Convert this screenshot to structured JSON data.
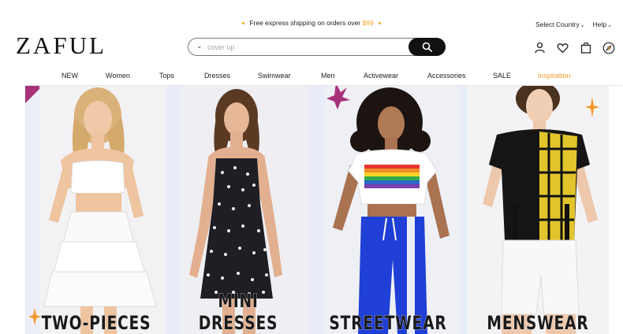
{
  "promo": {
    "text": "Free express shipping on orders over ",
    "price": "$99"
  },
  "utility": {
    "country": "Select Country",
    "help": "Help"
  },
  "brand": {
    "logo": "ZAFUL"
  },
  "search": {
    "placeholder": "cover up"
  },
  "icons": [
    "user-icon",
    "heart-icon",
    "bag-icon",
    "compass-icon"
  ],
  "nav": {
    "items": [
      "NEW",
      "Women",
      "Tops",
      "Dresses",
      "Swimwear",
      "Men",
      "Activewear",
      "Accessories",
      "SALE",
      "Inspiration"
    ]
  },
  "hero": {
    "panels": [
      {
        "caption": "TWO-PIECES"
      },
      {
        "caption": "MINI DRESSES"
      },
      {
        "caption": "STREETWEAR"
      },
      {
        "caption": "MENSWEAR"
      }
    ]
  },
  "colors": {
    "accent": "#f5a623",
    "inspiration": "#f39a2b",
    "search_button": "#111111",
    "hero_bg": "#f7f4f2"
  }
}
